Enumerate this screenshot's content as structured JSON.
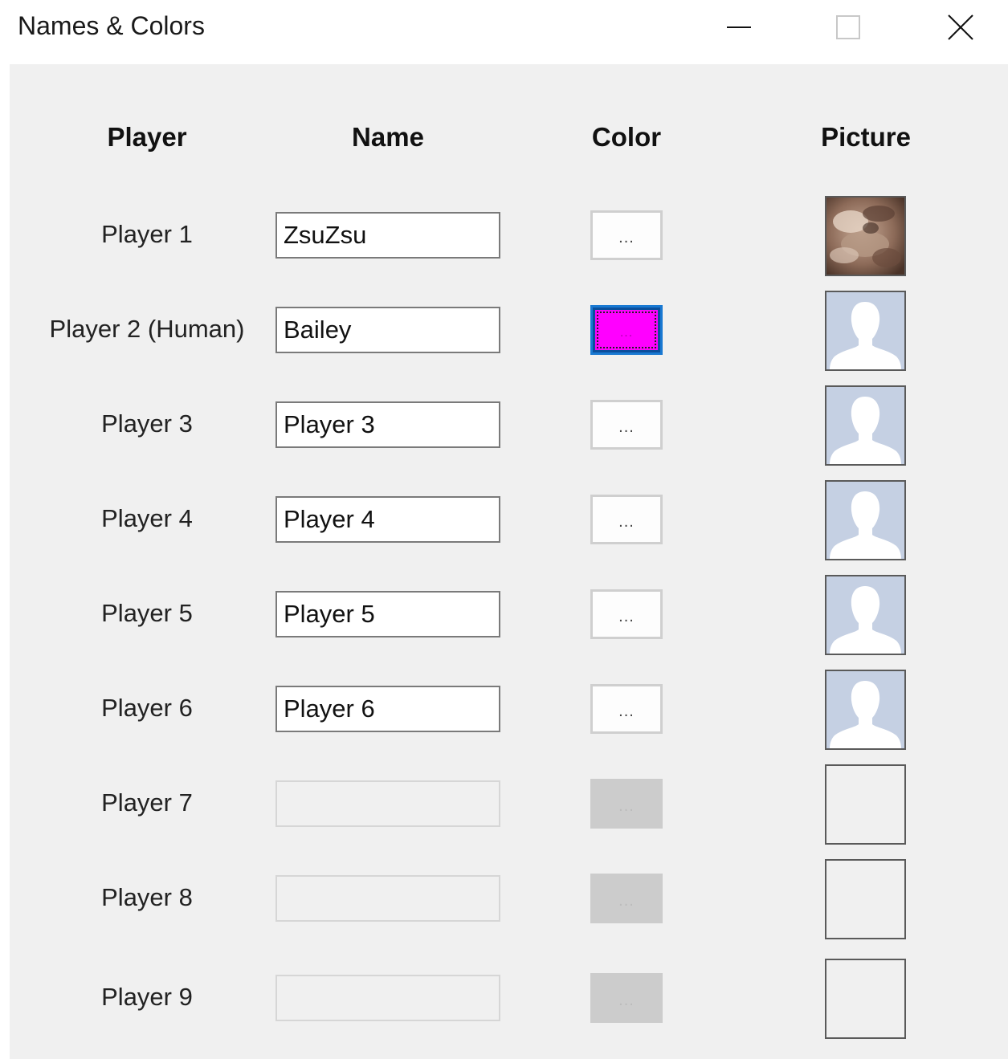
{
  "window": {
    "title": "Names & Colors",
    "controls": {
      "minimize": "minimize-icon",
      "maximize": "maximize-icon",
      "close": "close-icon"
    }
  },
  "headers": {
    "player": "Player",
    "name": "Name",
    "color": "Color",
    "picture": "Picture"
  },
  "players": [
    {
      "label": "Player 1",
      "name": "ZsuZsu",
      "enabled": true,
      "color_button": "...",
      "color": null,
      "picture": "photo"
    },
    {
      "label": "Player 2 (Human)",
      "name": "Bailey",
      "enabled": true,
      "color_button": "...",
      "color": "#ff00ff",
      "focused": true,
      "picture": "silhouette"
    },
    {
      "label": "Player 3",
      "name": "Player 3",
      "enabled": true,
      "color_button": "...",
      "color": null,
      "picture": "silhouette"
    },
    {
      "label": "Player 4",
      "name": "Player 4",
      "enabled": true,
      "color_button": "...",
      "color": null,
      "picture": "silhouette"
    },
    {
      "label": "Player 5",
      "name": "Player 5",
      "enabled": true,
      "color_button": "...",
      "color": null,
      "picture": "silhouette"
    },
    {
      "label": "Player 6",
      "name": "Player 6",
      "enabled": true,
      "color_button": "...",
      "color": null,
      "picture": "silhouette"
    },
    {
      "label": "Player 7",
      "name": "",
      "enabled": false,
      "color_button": "...",
      "color": null,
      "picture": "empty"
    },
    {
      "label": "Player 8",
      "name": "",
      "enabled": false,
      "color_button": "...",
      "color": null,
      "picture": "empty"
    },
    {
      "label": "Player 9",
      "name": "",
      "enabled": false,
      "color_button": "...",
      "color": null,
      "picture": "empty"
    }
  ]
}
